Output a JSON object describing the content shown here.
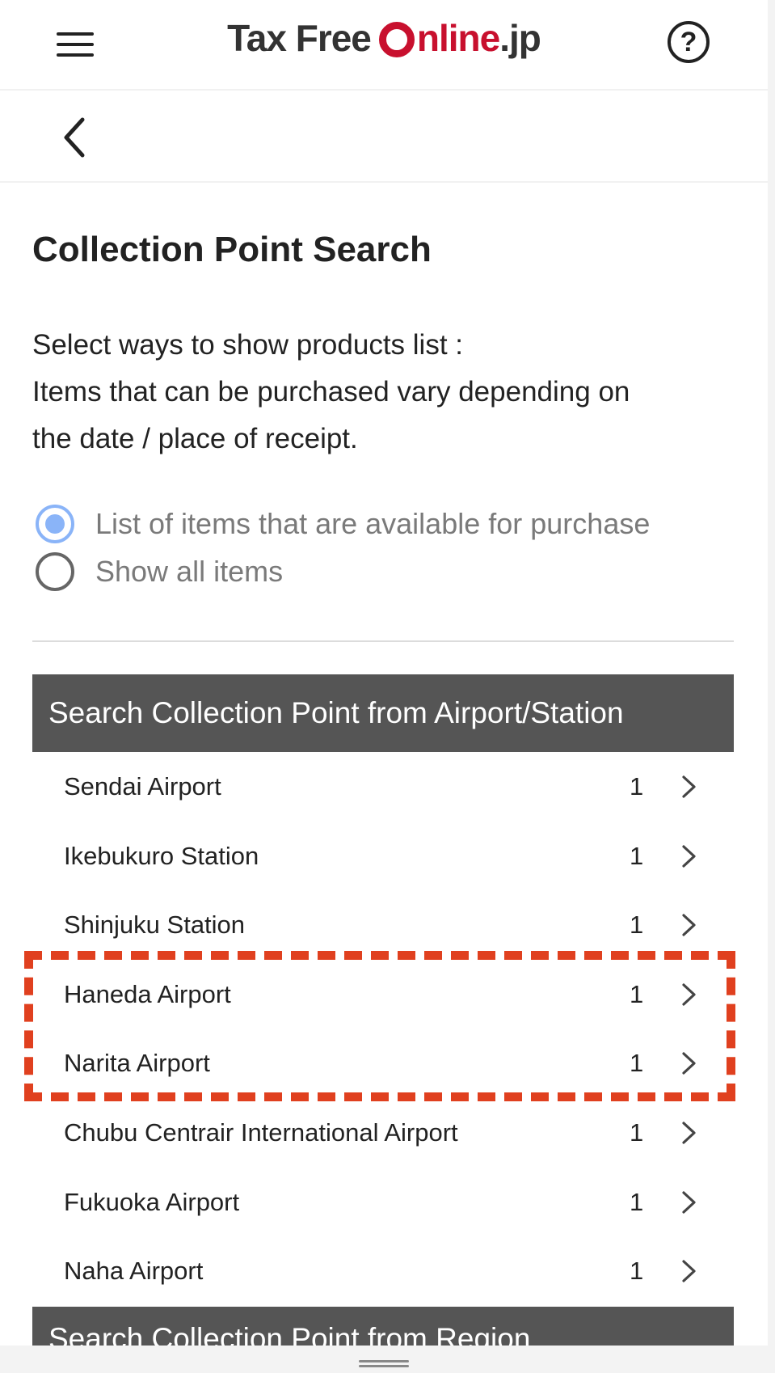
{
  "header": {
    "logo": {
      "part1": "Tax Free",
      "part2": "nline",
      "part3": ".jp"
    },
    "help_symbol": "?",
    "icons": {
      "menu": "hamburger-menu-icon",
      "help": "help-circle-icon",
      "back": "chevron-left-icon"
    }
  },
  "page": {
    "title": "Collection Point Search",
    "description_lines": [
      "Select ways to show products list :",
      "Items that can be purchased vary depending on",
      "the date / place of receipt."
    ]
  },
  "filter": {
    "options": [
      {
        "label": "List of items that are available for purchase",
        "checked": true
      },
      {
        "label": "Show all items",
        "checked": false
      }
    ]
  },
  "sections": {
    "airport_station": {
      "header": "Search Collection Point from Airport/Station",
      "items": [
        {
          "name": "Sendai Airport",
          "count": "1"
        },
        {
          "name": "Ikebukuro Station",
          "count": "1"
        },
        {
          "name": "Shinjuku Station",
          "count": "1"
        },
        {
          "name": "Haneda Airport",
          "count": "1"
        },
        {
          "name": "Narita Airport",
          "count": "1"
        },
        {
          "name": "Chubu Centrair International Airport",
          "count": "1"
        },
        {
          "name": "Fukuoka Airport",
          "count": "1"
        },
        {
          "name": "Naha Airport",
          "count": "1"
        }
      ]
    },
    "region": {
      "header": "Search Collection Point from Region"
    }
  },
  "colors": {
    "brand_red": "#c8102e",
    "section_header_bg": "#555555",
    "radio_selected": "#8ab4f8",
    "highlight_dashed": "#e0401f"
  }
}
